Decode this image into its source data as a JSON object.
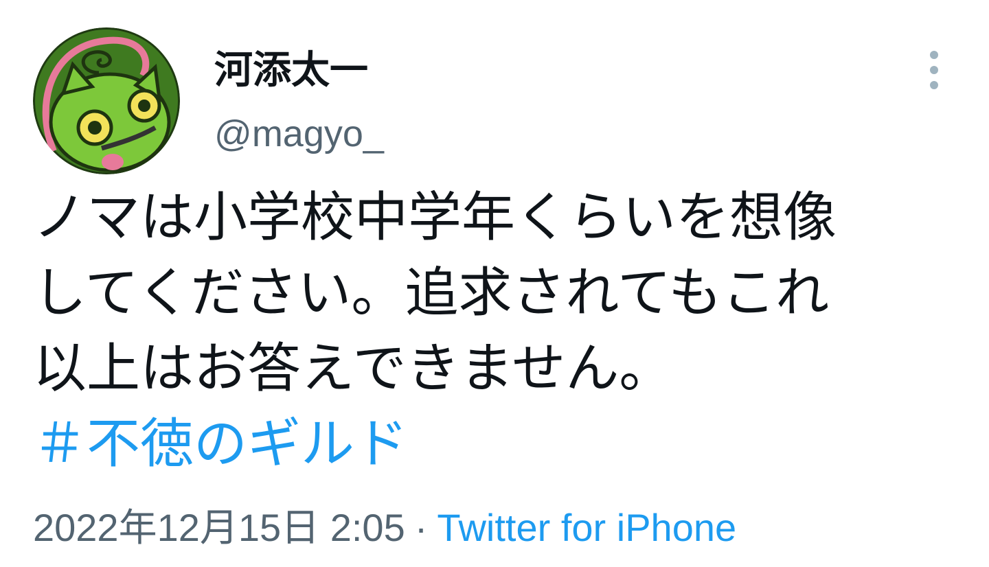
{
  "author": {
    "display_name": "河添太一",
    "handle": "@magyo_",
    "avatar_icon": "green-creature-avatar"
  },
  "tweet": {
    "text_lines": [
      "ノマは小学校中学年くらいを想像",
      "してください。追求されてもこれ",
      "以上はお答えできません。"
    ],
    "hashtag": "＃不徳のギルド"
  },
  "meta": {
    "timestamp": "2022年12月15日 2:05",
    "separator": "·",
    "source": "Twitter for iPhone"
  },
  "icons": {
    "more": "more-vertical-icon"
  },
  "colors": {
    "text": "#0f1419",
    "secondary": "#536471",
    "link": "#1d9bf0",
    "more_icon": "#9fb3bf"
  }
}
